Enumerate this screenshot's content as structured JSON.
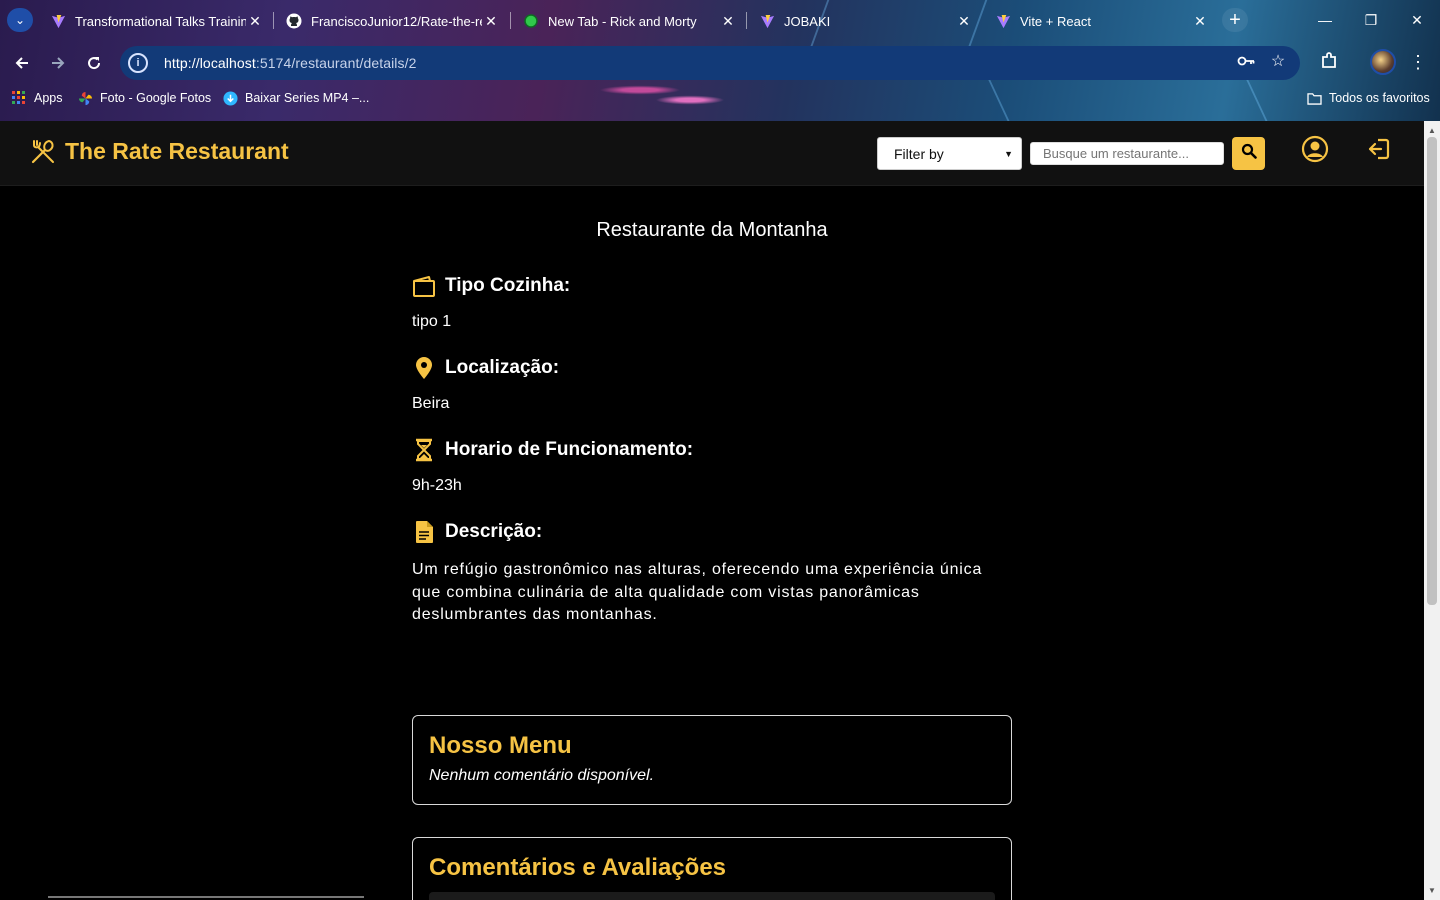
{
  "browser": {
    "tabs": [
      {
        "title": "Transformational Talks Training",
        "favicon": "vite-icon"
      },
      {
        "title": "FranciscoJunior12/Rate-the-res",
        "favicon": "github-icon"
      },
      {
        "title": "New Tab - Rick and Morty",
        "favicon": "green-dot-icon"
      },
      {
        "title": "JOBAKI",
        "favicon": "vite-icon"
      },
      {
        "title": "Vite + React",
        "favicon": "vite-icon"
      }
    ],
    "url_scheme_host": "http://localhost",
    "url_rest": ":5174/restaurant/details/2",
    "bookmarks": [
      {
        "label": "Apps",
        "icon": "apps-grid-icon"
      },
      {
        "label": "Foto - Google Fotos",
        "icon": "google-photos-icon"
      },
      {
        "label": "Baixar Series MP4 –...",
        "icon": "download-icon"
      }
    ],
    "all_bookmarks_label": "Todos os favoritos",
    "accent_color": "#123a78"
  },
  "navbar": {
    "brand_name": "The Rate Restaurant",
    "filter_label": "Filter by",
    "search_placeholder": "Busque um restaurante...",
    "brand_color": "#f6c344"
  },
  "restaurant": {
    "name": "Restaurante da Montanha",
    "cuisine_label": "Tipo Cozinha:",
    "cuisine_value": "tipo 1",
    "location_label": "Localização:",
    "location_value": "Beira",
    "hours_label": "Horario de Funcionamento:",
    "hours_value": "9h-23h",
    "description_label": "Descrição:",
    "description_value": "Um refúgio gastronômico nas alturas, oferecendo uma experiência única que combina culinária de alta qualidade com vistas panorâmicas deslumbrantes das montanhas."
  },
  "menu_card": {
    "title": "Nosso Menu",
    "empty_text": "Nenhum comentário disponível."
  },
  "reviews_card": {
    "title": "Comentários e Avaliações"
  }
}
